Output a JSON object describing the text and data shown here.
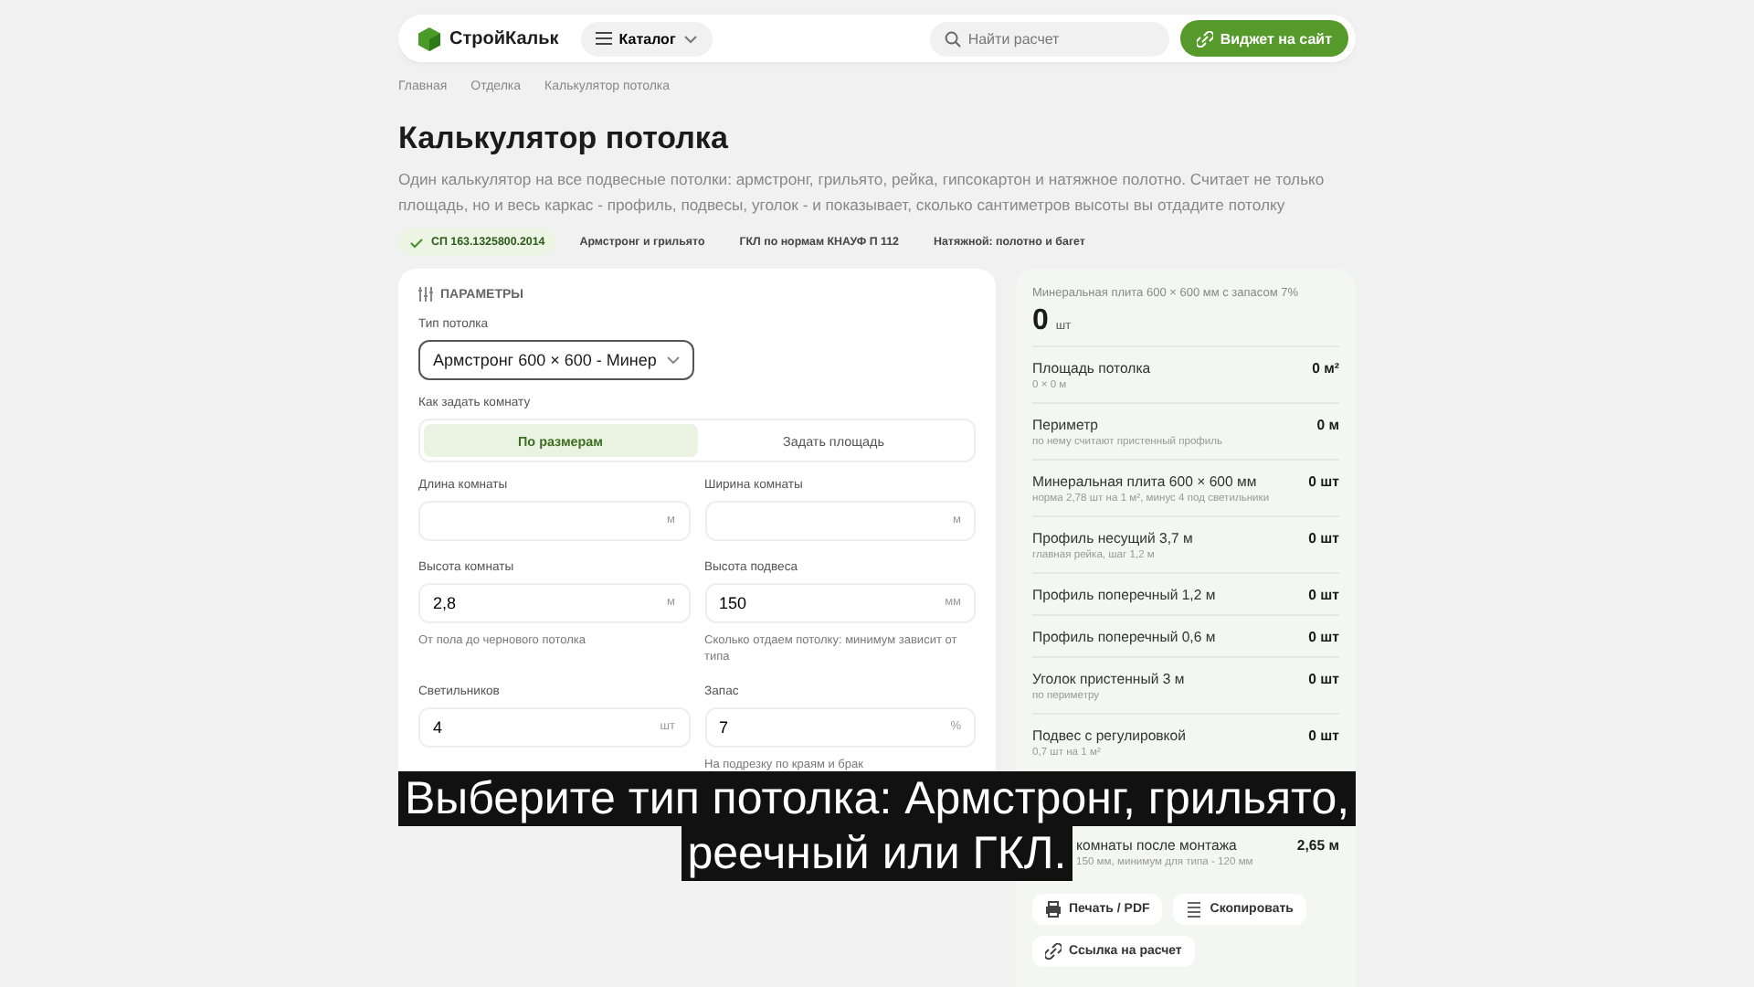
{
  "header": {
    "logo": "СтройКальк",
    "catalog": "Каталог",
    "search_placeholder": "Найти расчет",
    "widget_button": "Виджет на сайт"
  },
  "breadcrumbs": [
    "Главная",
    "Отделка",
    "Калькулятор потолка"
  ],
  "title": "Калькулятор потолка",
  "description": "Один калькулятор на все подвесные потолки: армстронг, грильято, рейка, гипсокартон и натяжное полотно. Считает не только площадь, но и весь каркас - профиль, подвесы, уголок - и показывает, сколько сантиметров высоты вы отдадите потолку",
  "tags": [
    {
      "label": "СП 163.1325800.2014",
      "checked": true
    },
    {
      "label": "Армстронг и грильято",
      "checked": false
    },
    {
      "label": "ГКЛ по нормам КНАУФ П 112",
      "checked": false
    },
    {
      "label": "Натяжной: полотно и багет",
      "checked": false
    }
  ],
  "params": {
    "heading": "ПАРАМЕТРЫ",
    "type_label": "Тип потолка",
    "type_value": "Армстронг 600 × 600 - Минер",
    "mode_label": "Как задать комнату",
    "modes": [
      {
        "label": "По размерам",
        "selected": true
      },
      {
        "label": "Задать площадь",
        "selected": false
      }
    ],
    "fields": [
      {
        "label": "Длина комнаты",
        "unit": "м"
      },
      {
        "label": "Ширина комнаты",
        "unit": "м"
      },
      {
        "label": "Высота комнаты",
        "value": "2,8",
        "unit": "м",
        "hint": "От пола до чернового потолка"
      },
      {
        "label": "Высота подвеса",
        "value": "150",
        "unit": "мм",
        "hint": "Сколько отдаем потолку: минимум зависит от типа"
      },
      {
        "label": "Светильников",
        "value": "4",
        "unit": "шт"
      },
      {
        "label": "Запас",
        "value": "7",
        "unit": "%",
        "hint": "На подрезку по краям и брак"
      }
    ]
  },
  "results": {
    "caption": "Минеральная плита 600 × 600 мм с запасом 7%",
    "total": "0",
    "total_unit": "шт",
    "rows": [
      {
        "kind": "full",
        "name": "Площадь потолка",
        "note": "0 × 0 м",
        "value": "0 м²"
      },
      {
        "kind": "full",
        "name": "Периметр",
        "note": "по нему считают пристенный профиль",
        "value": "0 м"
      },
      {
        "kind": "full",
        "name": "Минеральная плита 600 × 600 мм",
        "note": "норма 2,78 шт на 1 м², минус 4 под светильники",
        "value": "0 шт"
      },
      {
        "kind": "full",
        "name": "Профиль несущий 3,7 м",
        "note": "главная рейка, шаг 1,2 м",
        "value": "0 шт"
      },
      {
        "kind": "full",
        "name": "Профиль поперечный 1,2 м",
        "value": "0 шт"
      },
      {
        "kind": "full",
        "name": "Профиль поперечный 0,6 м",
        "value": "0 шт"
      },
      {
        "kind": "full",
        "name": "Уголок пристенный 3 м",
        "note": "по периметру",
        "value": "0 шт"
      },
      {
        "kind": "full",
        "name": "Подвес с регулировкой",
        "note": "0,7 шт на 1 м²",
        "value": "0 шт"
      },
      {
        "kind": "cut",
        "name": "комнаты после монтажа",
        "note": "150 мм, минимум для типа - 120 мм",
        "value": "2,65 м"
      }
    ],
    "actions": [
      {
        "label": "Печать / PDF"
      },
      {
        "label": "Скопировать"
      },
      {
        "label": "Ссылка на расчет"
      }
    ]
  },
  "subtitle": [
    "Выберите тип потолка: Армстронг, грильято,",
    "реечный или ГКЛ."
  ]
}
